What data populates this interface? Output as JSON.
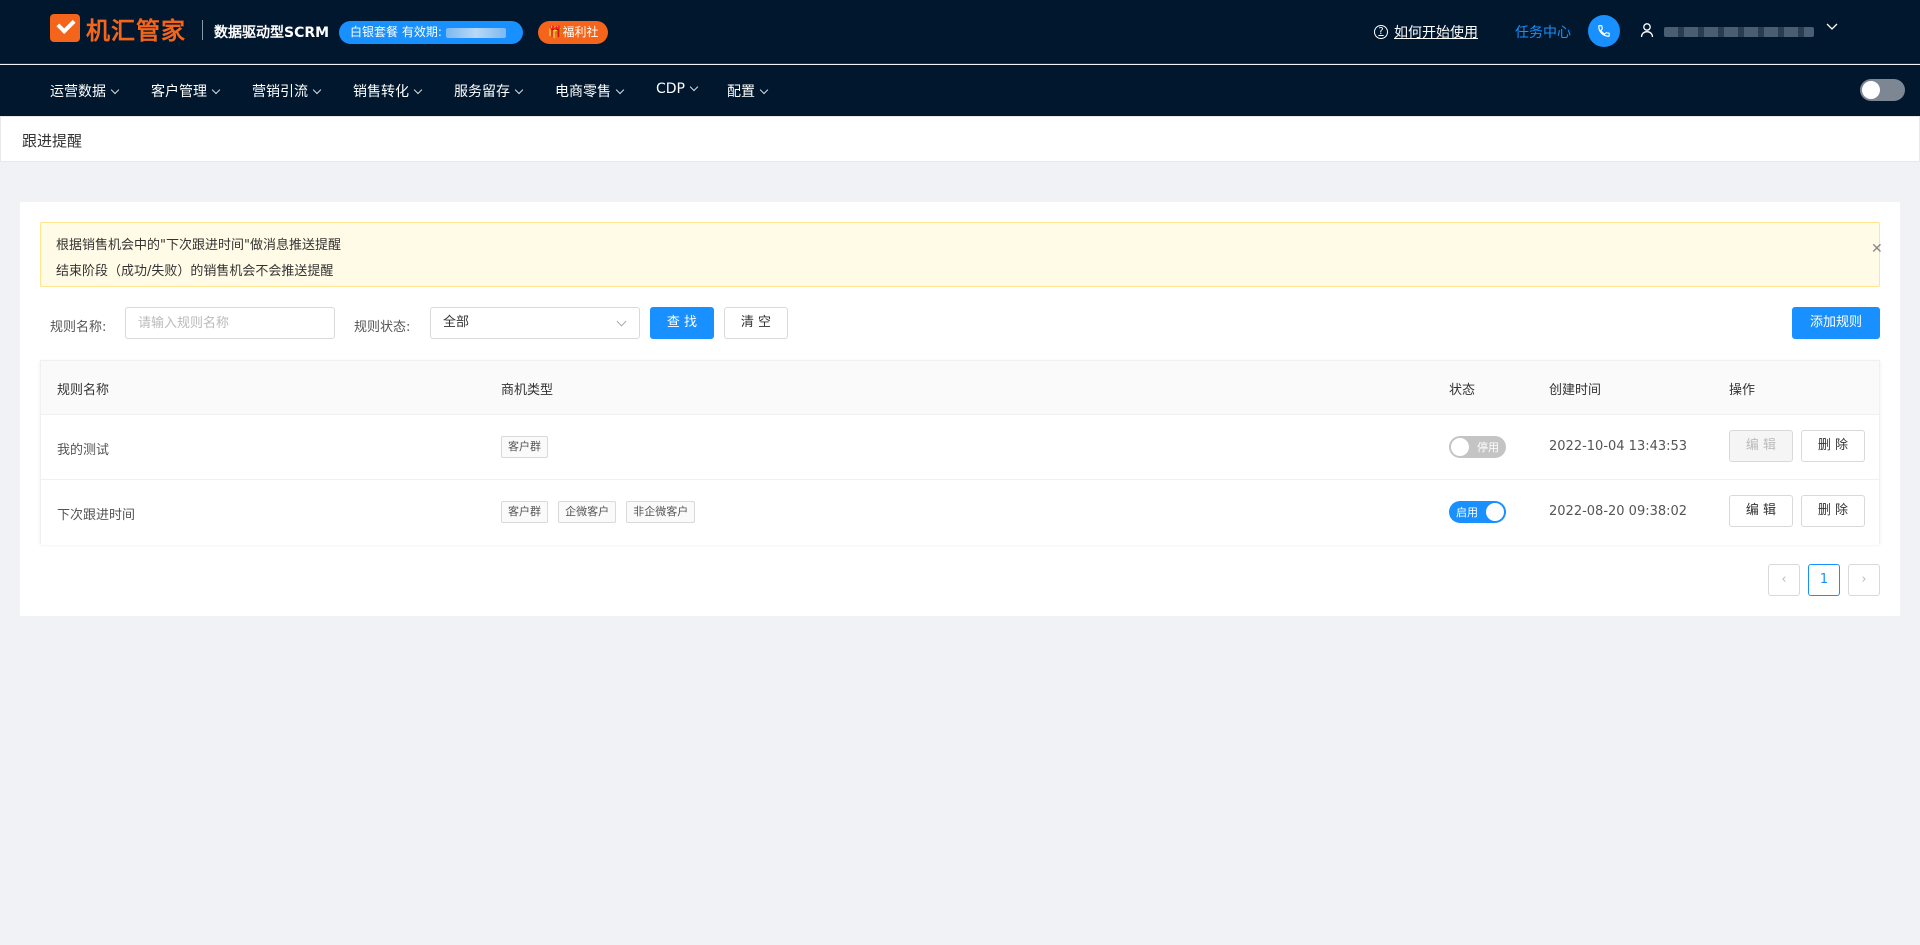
{
  "header": {
    "logo_text": "机汇管家",
    "product_name": "数据驱动型SCRM",
    "plan_label": "白银套餐 有效期:",
    "welfare_label": "福利社",
    "help_link": "如何开始使用",
    "task_center": "任务中心"
  },
  "nav": {
    "items": [
      {
        "label": "运营数据"
      },
      {
        "label": "客户管理"
      },
      {
        "label": "营销引流"
      },
      {
        "label": "销售转化"
      },
      {
        "label": "服务留存"
      },
      {
        "label": "电商零售"
      },
      {
        "label": "CDP"
      },
      {
        "label": "配置"
      }
    ]
  },
  "page": {
    "title": "跟进提醒"
  },
  "alert": {
    "line1": "根据销售机会中的\"下次跟进时间\"做消息推送提醒",
    "line2": "结束阶段（成功/失败）的销售机会不会推送提醒"
  },
  "filters": {
    "name_label": "规则名称:",
    "name_placeholder": "请输入规则名称",
    "status_label": "规则状态:",
    "status_value": "全部",
    "search_button": "查 找",
    "clear_button": "清 空",
    "add_button": "添加规则"
  },
  "table": {
    "headers": {
      "name": "规则名称",
      "type": "商机类型",
      "status": "状态",
      "created": "创建时间",
      "actions": "操作"
    },
    "rows": [
      {
        "name": "我的测试",
        "tags": [
          "客户群"
        ],
        "status_label": "停用",
        "enabled": false,
        "created": "2022-10-04 13:43:53",
        "edit": "编 辑",
        "delete": "删 除"
      },
      {
        "name": "下次跟进时间",
        "tags": [
          "客户群",
          "企微客户",
          "非企微客户"
        ],
        "status_label": "启用",
        "enabled": true,
        "created": "2022-08-20 09:38:02",
        "edit": "编 辑",
        "delete": "删 除"
      }
    ]
  },
  "pagination": {
    "current": "1",
    "prev": "‹",
    "next": "›"
  },
  "colors": {
    "header_bg": "#00172e",
    "accent": "#1890ff",
    "brand": "#f4651b"
  }
}
